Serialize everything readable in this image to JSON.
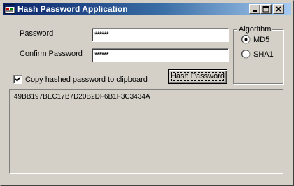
{
  "window": {
    "title": "Hash Password Application"
  },
  "form": {
    "password_label": "Password",
    "password_value": "******",
    "confirm_label": "Confirm Password",
    "confirm_value": "******",
    "copy_checkbox_label": "Copy hashed password to clipboard",
    "copy_checked": true,
    "hash_button_label": "Hash Password",
    "output_value": "49BB197BEC17B7D20B2DF6B1F3C3434A"
  },
  "algorithm": {
    "legend": "Algorithm",
    "options": [
      {
        "label": "MD5",
        "selected": true
      },
      {
        "label": "SHA1",
        "selected": false
      }
    ]
  },
  "colors": {
    "title_bar_start": "#0a246a",
    "title_bar_end": "#a6caf0",
    "window_face": "#d4d0c8"
  }
}
